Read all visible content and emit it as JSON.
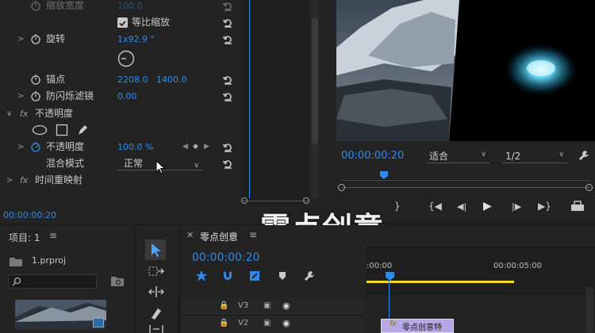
{
  "effect_controls": {
    "rows": [
      {
        "label": "缩放宽度",
        "value": "100.0"
      },
      {
        "label": "等比缩放"
      },
      {
        "label": "旋转",
        "value": "1x92.9 °"
      },
      {
        "label": "锚点",
        "value_x": "2208.0",
        "value_y": "1400.0"
      },
      {
        "label": "防闪烁滤镜",
        "value": "0.00"
      },
      {
        "label": "不透明度"
      },
      {
        "label": "不透明度",
        "value": "100.0 %"
      },
      {
        "label": "混合模式",
        "value": "正常"
      },
      {
        "label": "时间重映射"
      }
    ],
    "fx_label": "fx",
    "timecode": "00:00:00:20"
  },
  "program_monitor": {
    "timecode": "00:00:00:20",
    "fit_value": "适合",
    "resolution_value": "1/2"
  },
  "project_panel": {
    "title": "项目: 1",
    "file_name": "1.prproj"
  },
  "timeline": {
    "tab_title": "零点创意",
    "timecode": "00:00:00:20",
    "ruler_start": ":00:00",
    "ruler_mark": "00:00:05:00",
    "tracks": [
      "V3",
      "V2"
    ],
    "clip_label": "零点创意特",
    "clip_fx": "fx"
  },
  "watermark": "零点创意",
  "colors": {
    "accent": "#2d8ceb",
    "work_area": "#f4d81c",
    "clip": "#b6a8e8"
  }
}
